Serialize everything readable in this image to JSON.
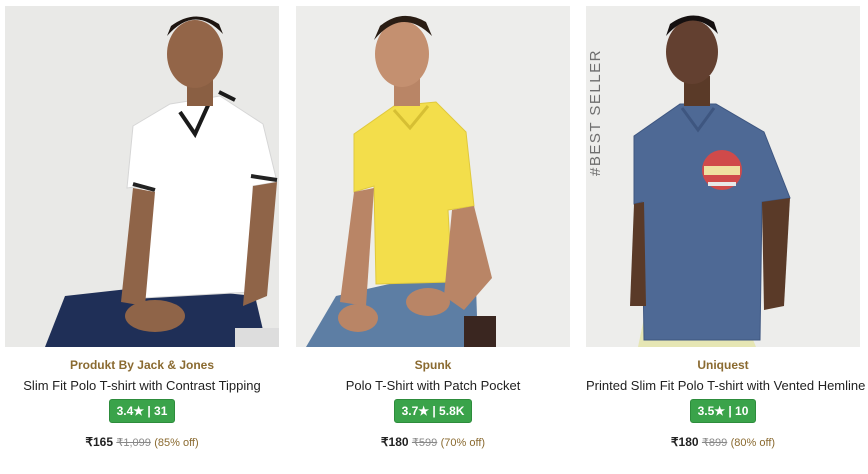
{
  "products": [
    {
      "brand": "Produkt By Jack & Jones",
      "title": "Slim Fit Polo T-shirt with Contrast Tipping",
      "rating": "3.4★ | 31",
      "price": "₹165",
      "mrp": "₹1,099",
      "discount": "(85% off)",
      "shirt_color": "#ffffff",
      "bg_color": "#e8e8e6",
      "badge": ""
    },
    {
      "brand": "Spunk",
      "title": "Polo T-Shirt with Patch Pocket",
      "rating": "3.7★ | 5.8K",
      "price": "₹180",
      "mrp": "₹599",
      "discount": "(70% off)",
      "shirt_color": "#f3df4c",
      "bg_color": "#ececea",
      "badge": ""
    },
    {
      "brand": "Uniquest",
      "title": "Printed Slim Fit Polo T-shirt with Vented Hemline",
      "rating": "3.5★ | 10",
      "price": "₹180",
      "mrp": "₹899",
      "discount": "(80% off)",
      "shirt_color": "#4f6a96",
      "bg_color": "#ececea",
      "badge": "#BEST SELLER"
    }
  ],
  "colors": {
    "brand_text": "#8a6a30",
    "rating_bg": "#3aa34a"
  }
}
